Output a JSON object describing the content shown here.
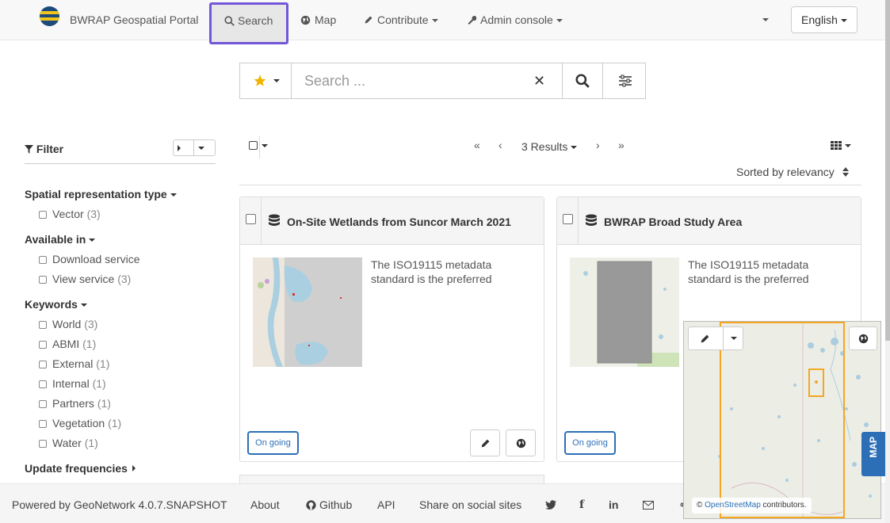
{
  "header": {
    "brand": "BWRAP Geospatial Portal",
    "nav": [
      {
        "label": "Search",
        "icon": "search-icon"
      },
      {
        "label": "Map",
        "icon": "globe-icon"
      },
      {
        "label": "Contribute",
        "icon": "pencil-icon"
      },
      {
        "label": "Admin console",
        "icon": "wrench-icon"
      }
    ],
    "language": "English"
  },
  "search": {
    "placeholder": "Search ..."
  },
  "filter": {
    "title": "Filter",
    "facets": [
      {
        "title": "Spatial representation type",
        "items": [
          {
            "label": "Vector",
            "count": "(3)"
          }
        ]
      },
      {
        "title": "Available in",
        "items": [
          {
            "label": "Download service",
            "count": ""
          },
          {
            "label": "View service",
            "count": "(3)"
          }
        ]
      },
      {
        "title": "Keywords",
        "items": [
          {
            "label": "World",
            "count": "(3)"
          },
          {
            "label": "ABMI",
            "count": "(1)"
          },
          {
            "label": "External",
            "count": "(1)"
          },
          {
            "label": "Internal",
            "count": "(1)"
          },
          {
            "label": "Partners",
            "count": "(1)"
          },
          {
            "label": "Vegetation",
            "count": "(1)"
          },
          {
            "label": "Water",
            "count": "(1)"
          }
        ]
      },
      {
        "title": "Update frequencies",
        "items": []
      }
    ]
  },
  "results": {
    "count_label": "3 Results",
    "sort_label": "Sorted by relevancy",
    "cards": [
      {
        "title": "On-Site Wetlands from Suncor March 2021",
        "abstract": "The ISO19115 metadata standard is the preferred",
        "status": "On going"
      },
      {
        "title": "BWRAP Broad Study Area",
        "abstract": "The ISO19115 metadata standard is the preferred",
        "status": "On going"
      }
    ]
  },
  "minimap": {
    "attribution_link": "OpenStreetMap",
    "attribution_suffix": "contributors.",
    "copyright": "©",
    "tab": "MAP"
  },
  "footer": {
    "powered": "Powered by GeoNetwork 4.0.7.SNAPSHOT",
    "about": "About",
    "github": "Github",
    "api": "API",
    "share": "Share on social sites"
  },
  "colors": {
    "accent": "#7257d8",
    "link": "#2c6fb7",
    "extent": "#f5a623"
  }
}
